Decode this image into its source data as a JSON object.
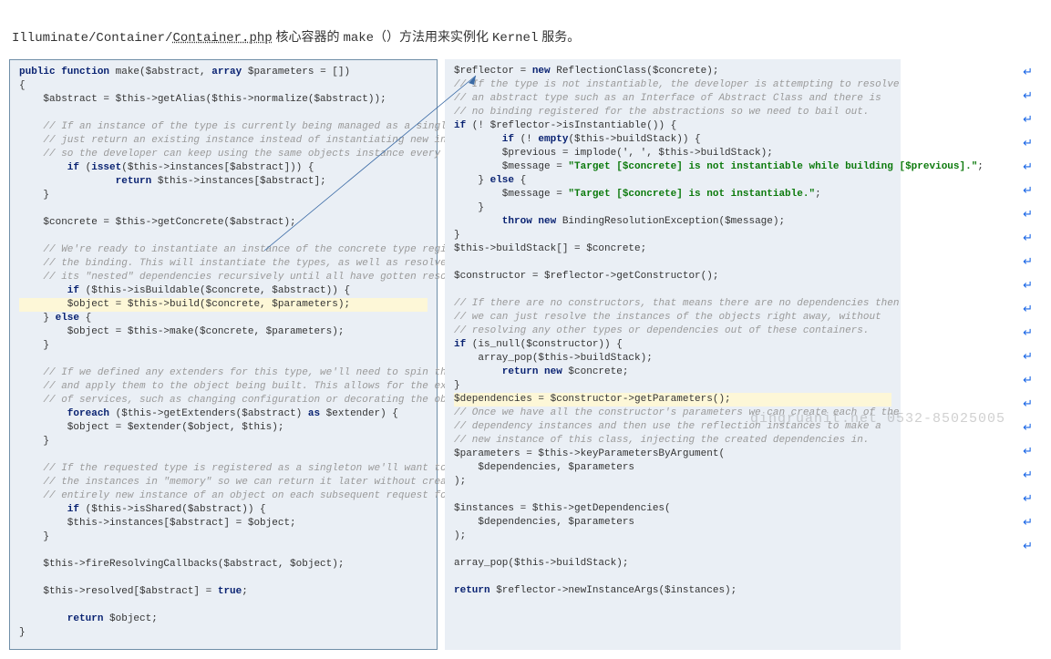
{
  "heading_prefix": "Illuminate/Container/",
  "heading_file": "Container.php",
  "heading_zh1": " 核心容器的 ",
  "heading_make": "make（）",
  "heading_zh2": "方法用来实例化 ",
  "heading_kernel": "Kernel",
  "heading_zh3": " 服务。",
  "left": {
    "l01a": "public function",
    "l01b": " make($abstract, ",
    "l01c": "array",
    "l01d": " $parameters = [])",
    "l02": "{",
    "l03": "    $abstract = $this->getAlias($this->normalize($abstract));",
    "l04a": "    // If an instance of the type is currently being managed as a singleton we'll",
    "l04b": "    // just return an existing instance instead of instantiating new instances",
    "l04c": "    // so the developer can keep using the same objects instance every time.",
    "l05a": "    if",
    "l05b": " (",
    "l05c": "isset",
    "l05d": "($this->instances[$abstract])) {",
    "l06a": "        return",
    "l06b": " $this->instances[$abstract];",
    "l07": "    }",
    "l08": "    $concrete = $this->getConcrete($abstract);",
    "l09a": "    // We're ready to instantiate an instance of the concrete type registered for",
    "l09b": "    // the binding. This will instantiate the types, as well as resolve any of",
    "l09c": "    // its \"nested\" dependencies recursively until all have gotten resolved.",
    "l10a": "    if",
    "l10b": " ($this->isBuildable($concrete, $abstract)) {",
    "l11": "        $object = $this->build($concrete, $parameters);",
    "l12a": "    } ",
    "l12b": "else",
    "l12c": " {",
    "l13": "        $object = $this->make($concrete, $parameters);",
    "l14": "    }",
    "l15a": "    // If we defined any extenders for this type, we'll need to spin through them",
    "l15b": "    // and apply them to the object being built. This allows for the extension",
    "l15c": "    // of services, such as changing configuration or decorating the object.",
    "l16a": "    foreach",
    "l16b": " ($this->getExtenders($abstract) ",
    "l16c": "as",
    "l16d": " $extender) {",
    "l17": "        $object = $extender($object, $this);",
    "l18": "    }",
    "l19a": "    // If the requested type is registered as a singleton we'll want to cache off",
    "l19b": "    // the instances in \"memory\" so we can return it later without creating an",
    "l19c": "    // entirely new instance of an object on each subsequent request for it.",
    "l20a": "    if",
    "l20b": " ($this->isShared($abstract)) {",
    "l21": "        $this->instances[$abstract] = $object;",
    "l22": "    }",
    "l23": "    $this->fireResolvingCallbacks($abstract, $object);",
    "l24a": "    $this->resolved[$abstract] = ",
    "l24b": "true",
    "l24c": ";",
    "l25a": "    return",
    "l25b": " $object;",
    "l26": "}"
  },
  "right": {
    "r01a": "$reflector = ",
    "r01b": "new",
    "r01c": " ReflectionClass($concrete);",
    "r02a": "// If the type is not instantiable, the developer is attempting to resolve",
    "r02b": "// an abstract type such as an Interface of Abstract Class and there is",
    "r02c": "// no binding registered for the abstractions so we need to bail out.",
    "r03a": "if",
    "r03b": " (! $reflector->isInstantiable()) {",
    "r04a": "    if",
    "r04b": " (! ",
    "r04c": "empty",
    "r04d": "($this->buildStack)) {",
    "r05": "        $previous = implode(', ', $this->buildStack);",
    "r06a": "        $message = ",
    "r06b": "\"Target [$concrete] is not instantiable while building [$previous].\"",
    "r06c": ";",
    "r07a": "    } ",
    "r07b": "else",
    "r07c": " {",
    "r08a": "        $message = ",
    "r08b": "\"Target [$concrete] is not instantiable.\"",
    "r08c": ";",
    "r09": "    }",
    "r10a": "    throw new",
    "r10b": " BindingResolutionException($message);",
    "r11": "}",
    "r12": "$this->buildStack[] = $concrete;",
    "r13": "$constructor = $reflector->getConstructor();",
    "r14a": "// If there are no constructors, that means there are no dependencies then",
    "r14b": "// we can just resolve the instances of the objects right away, without",
    "r14c": "// resolving any other types or dependencies out of these containers.",
    "r15a": "if",
    "r15b": " (is_null($constructor)) {",
    "r16": "    array_pop($this->buildStack);",
    "r17a": "    return new",
    "r17b": " $concrete;",
    "r18": "}",
    "r19": "$dependencies = $constructor->getParameters();",
    "r20a": "// Once we have all the constructor's parameters we can create each of the",
    "r20b": "// dependency instances and then use the reflection instances to make a",
    "r20c": "// new instance of this class, injecting the created dependencies in.",
    "r21": "$parameters = $this->keyParametersByArgument(",
    "r22": "    $dependencies, $parameters",
    "r23": ");",
    "r24": "$instances = $this->getDependencies(",
    "r25": "    $dependencies, $parameters",
    "r26": ");",
    "r27": "array_pop($this->buildStack);",
    "r28a": "return",
    "r28b": " $reflector->newInstanceArgs($instances);"
  },
  "watermark": "qingruanit.net 0532-85025005",
  "arrow": "↵"
}
